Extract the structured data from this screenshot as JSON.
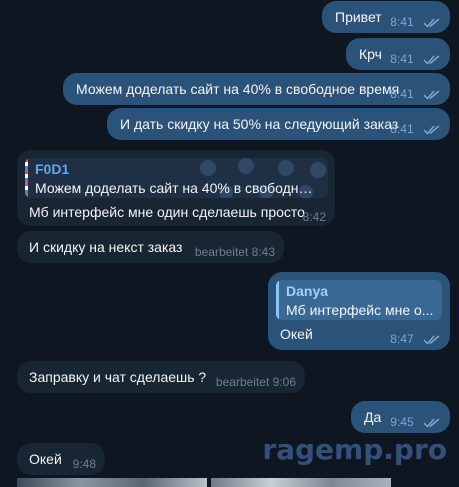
{
  "colors": {
    "background": "#0e1621",
    "outgoing_bubble": "#2b5278",
    "incoming_bubble": "#182533",
    "accent_blue": "#5fa8e8",
    "watermark": "#33507a"
  },
  "messages": [
    {
      "direction": "outgoing",
      "text": "Привет",
      "time": "8:41",
      "read": true
    },
    {
      "direction": "outgoing",
      "text": "Крч",
      "time": "8:41",
      "read": true
    },
    {
      "direction": "outgoing",
      "text": "Можем доделать сайт на 40% в свободное время",
      "time": "8:41",
      "read": true
    },
    {
      "direction": "outgoing",
      "text": "И дать скидку на 50% на следующий заказ",
      "time": "8:41",
      "read": true
    },
    {
      "direction": "incoming",
      "reply_to": {
        "name": "F0D1",
        "snippet": "Можем доделать сайт на 40% в свободное ..."
      },
      "text": "Мб интерфейс мне один сделаешь просто",
      "time": "8:42"
    },
    {
      "direction": "incoming",
      "text": "И скидку на некст заказ",
      "edited": "bearbeitet",
      "time": "8:43"
    },
    {
      "direction": "outgoing",
      "reply_to": {
        "name": "Danya",
        "snippet": "Мб интерфейс мне о..."
      },
      "text": "Окей",
      "time": "8:47",
      "read": true
    },
    {
      "direction": "incoming",
      "text": "Заправку и чат сделаешь ?",
      "edited": "bearbeitet",
      "time": "9:06"
    },
    {
      "direction": "outgoing",
      "text": "Да",
      "time": "9:45",
      "read": true
    },
    {
      "direction": "incoming",
      "text": "Окей",
      "time": "9:48"
    }
  ],
  "watermark": "ragemp.pro",
  "icons": {
    "read_receipt": "double-check-icon"
  }
}
